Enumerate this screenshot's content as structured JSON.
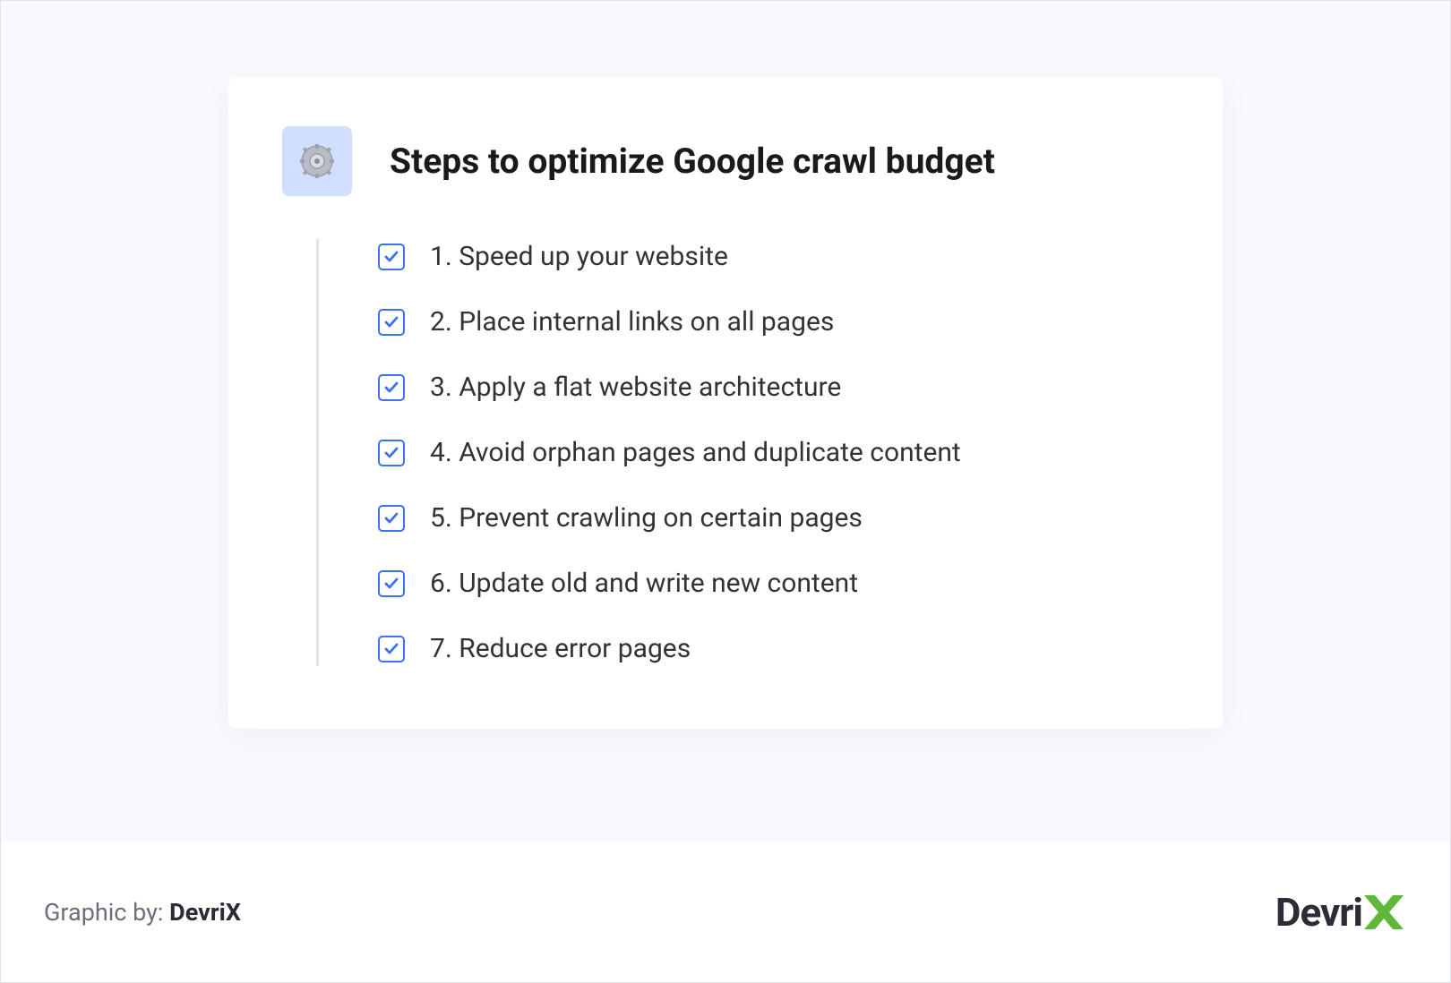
{
  "card": {
    "title": "Steps to optimize Google crawl budget",
    "icon_name": "gear-icon"
  },
  "steps": [
    {
      "text": "1. Speed up your website"
    },
    {
      "text": "2. Place internal links on all pages"
    },
    {
      "text": "3. Apply a flat website architecture"
    },
    {
      "text": "4. Avoid orphan pages and duplicate content"
    },
    {
      "text": "5. Prevent crawling on certain pages"
    },
    {
      "text": "6. Update old and write new content"
    },
    {
      "text": "7. Reduce error pages"
    }
  ],
  "footer": {
    "credit_prefix": "Graphic by: ",
    "credit_brand": "DevriX",
    "logo_text": "Devri"
  },
  "colors": {
    "icon_box_bg": "#d1deff",
    "check_border": "#3b72f1",
    "logo_accent": "#5fb83b"
  }
}
